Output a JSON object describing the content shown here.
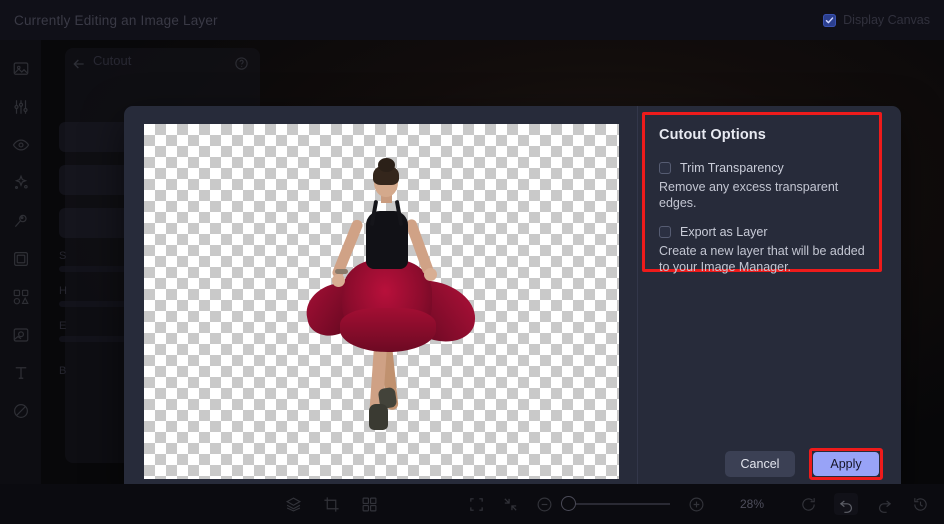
{
  "topbar": {
    "title": "Currently Editing an Image Layer",
    "display_canvas_label": "Display Canvas",
    "display_canvas_checked": "true",
    "accent_checkbox": "#2b3f8f"
  },
  "sidebar": {
    "items": [
      {
        "icon": "image-layer-icon",
        "label": "Image Layer"
      },
      {
        "icon": "adjustments-sliders-icon",
        "label": "Adjustments"
      },
      {
        "icon": "eye-visibility-icon",
        "label": "Visibility"
      },
      {
        "icon": "effects-sparkle-icon",
        "label": "Effects"
      },
      {
        "icon": "magic-wand-icon",
        "label": "Magic Tools"
      },
      {
        "icon": "frame-border-icon",
        "label": "Frames"
      },
      {
        "icon": "shapes-grid-icon",
        "label": "Shapes"
      },
      {
        "icon": "picture-icon",
        "label": "Pictures"
      },
      {
        "icon": "text-tool-icon",
        "label": "Text"
      },
      {
        "icon": "mask-opacity-icon",
        "label": "Mask"
      }
    ]
  },
  "background_panel": {
    "title": "Cutout",
    "back_icon": "back-arrow-icon",
    "help_icon": "help-circle-icon",
    "rows": [
      "S",
      "H",
      "E",
      "B"
    ]
  },
  "modal": {
    "preview": {
      "type": "transparency-checkerboard",
      "subject": "dancer-in-red-skirt"
    },
    "options": {
      "title": "Cutout Options",
      "items": [
        {
          "label": "Trim Transparency",
          "checked": "false",
          "description": "Remove any excess transparent edges."
        },
        {
          "label": "Export as Layer",
          "checked": "false",
          "description": "Create a new layer that will be added to your Image Manager."
        }
      ],
      "highlight_color": "#ee1b1b"
    },
    "actions": {
      "cancel_label": "Cancel",
      "apply_label": "Apply",
      "apply_color": "#98a3f7",
      "apply_highlight_color": "#ee1b1b"
    }
  },
  "bottombar": {
    "left_tools": [
      {
        "icon": "layers-icon",
        "label": "Layers"
      },
      {
        "icon": "crop-transform-icon",
        "label": "Transform"
      },
      {
        "icon": "grid-icon",
        "label": "Grid"
      }
    ],
    "view_tools": [
      {
        "icon": "fit-to-screen-icon",
        "label": "Fit to screen"
      },
      {
        "icon": "collapse-arrows-icon",
        "label": "Collapse"
      }
    ],
    "zoom": {
      "minus_icon": "zoom-out-icon",
      "plus_icon": "zoom-in-icon",
      "value": "28%",
      "slider_position": "7"
    },
    "history_tools": [
      {
        "icon": "reset-icon",
        "label": "Reset",
        "active": "false"
      },
      {
        "icon": "undo-icon",
        "label": "Undo",
        "active": "true"
      },
      {
        "icon": "redo-icon",
        "label": "Redo",
        "active": "false"
      },
      {
        "icon": "history-icon",
        "label": "History",
        "active": "false"
      }
    ]
  }
}
